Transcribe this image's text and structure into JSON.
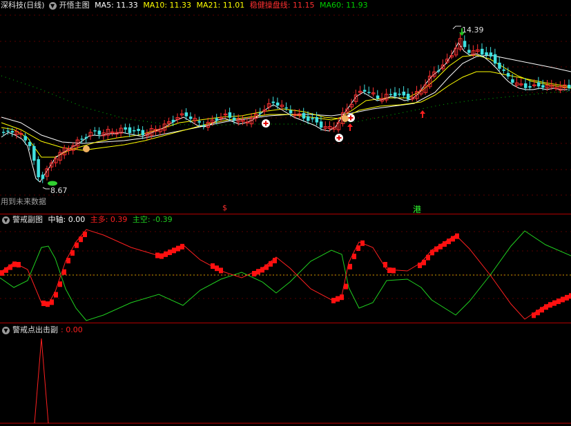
{
  "main": {
    "title": "深科技(日线)",
    "indicator": "开悟主图",
    "ma": [
      {
        "label": "MA5: 11.33",
        "color": "#ffffff"
      },
      {
        "label": "MA10: 11.33",
        "color": "#ffff00"
      },
      {
        "label": "MA21: 11.01",
        "color": "#ffff00"
      },
      {
        "label": "稳健操盘线: 11.15",
        "color": "#ff3030"
      },
      {
        "label": "MA60: 11.93",
        "color": "#00d000"
      }
    ],
    "price_high": "14.39",
    "price_low": "8.67",
    "future_note": "用到未来数据",
    "mark_red": "$",
    "mark_green": "港"
  },
  "sub1": {
    "title": "警戒副图",
    "zhongzhou": "中轴: 0.00",
    "zhuduo": "主多: 0.39",
    "zhukong": "主空: -0.39",
    "colors": {
      "duo": "#ff2020",
      "kong": "#20d020"
    }
  },
  "sub2": {
    "title": "警戒点出击副",
    "value": ": 0.00"
  },
  "chart_data": [
    {
      "type": "candlestick",
      "title": "深科技(日线)",
      "price_high": 14.39,
      "price_low": 8.67,
      "series": [
        {
          "name": "MA5",
          "value": 11.33
        },
        {
          "name": "MA10",
          "value": 11.33
        },
        {
          "name": "MA21",
          "value": 11.01
        },
        {
          "name": "稳健操盘线",
          "value": 11.15
        },
        {
          "name": "MA60",
          "value": 11.93
        }
      ]
    },
    {
      "type": "line",
      "title": "警戒副图",
      "series": [
        {
          "name": "中轴",
          "value": 0.0
        },
        {
          "name": "主多",
          "value": 0.39
        },
        {
          "name": "主空",
          "value": -0.39
        }
      ]
    },
    {
      "type": "line",
      "title": "警戒点出击副",
      "value": 0.0
    }
  ]
}
